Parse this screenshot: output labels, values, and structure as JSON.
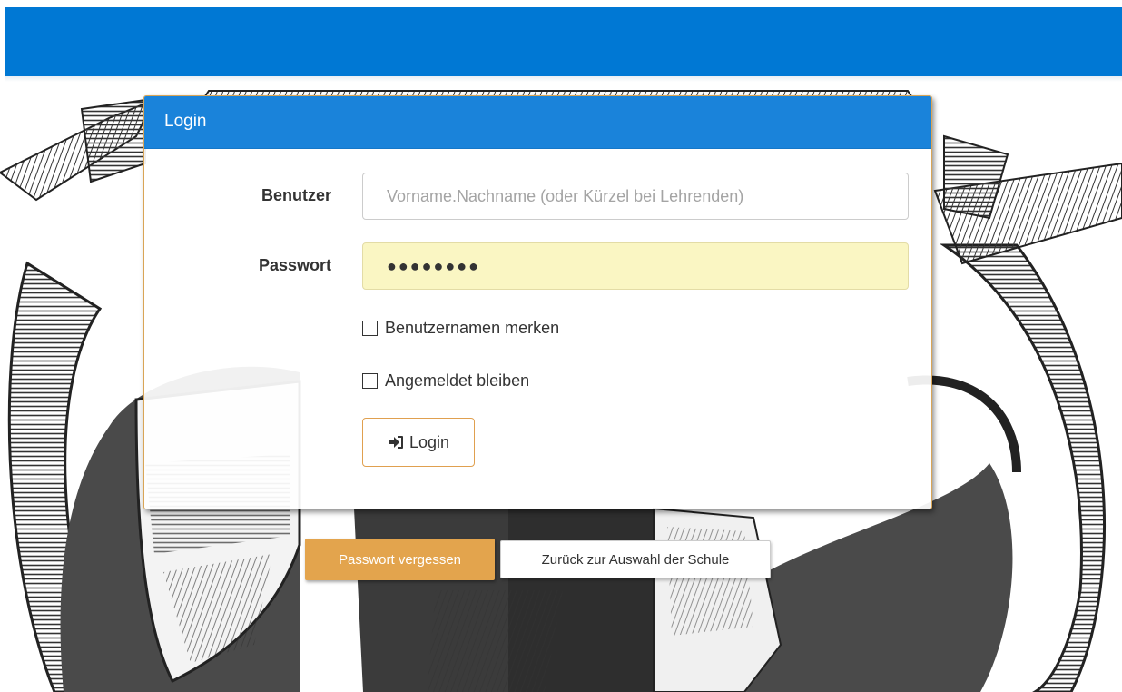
{
  "panel": {
    "title": "Login"
  },
  "form": {
    "user_label": "Benutzer",
    "user_placeholder": "Vorname.Nachname (oder Kürzel bei Lehrenden)",
    "user_value": "",
    "password_label": "Passwort",
    "password_value": "●●●●●●●●",
    "remember_user_label": "Benutzernamen merken",
    "remember_user_checked": false,
    "stay_logged_in_label": "Angemeldet bleiben",
    "stay_logged_in_checked": false,
    "login_label": "Login",
    "login_icon": "sign-in-icon"
  },
  "footer": {
    "forgot_label": "Passwort vergessen",
    "back_label": "Zurück zur Auswahl der Schule"
  },
  "colors": {
    "topbar": "#0078d4",
    "panel_heading": "#1a83da",
    "accent_orange": "#e3a44d",
    "autofill_yellow": "#faf5be"
  }
}
